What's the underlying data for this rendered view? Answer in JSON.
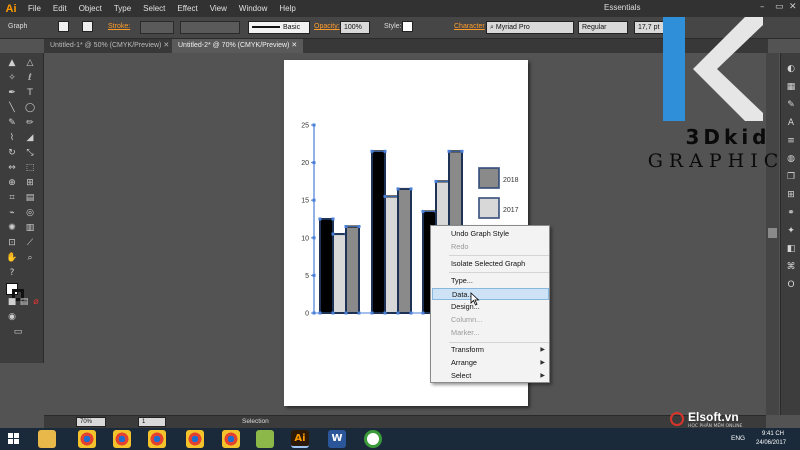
{
  "app": {
    "logo": "Ai"
  },
  "menubar": {
    "items": [
      "File",
      "Edit",
      "Object",
      "Type",
      "Select",
      "Effect",
      "View",
      "Window",
      "Help"
    ],
    "workspace": "Essentials",
    "win_min": "–",
    "win_max": "▭",
    "win_close": "✕"
  },
  "control_bar": {
    "selection_type": "Graph",
    "stroke_label": "Stroke:",
    "stroke_style": "Basic",
    "opacity_label": "Opacity:",
    "opacity_value": "100%",
    "style_label": "Style:",
    "character_label": "Character",
    "font_name": "Myriad Pro",
    "font_style": "Regular",
    "font_size": "17,7 pt",
    "fill_color": "#ffffff",
    "stroke_color": "#ffffff"
  },
  "tabs": [
    {
      "label": "Untitled-1* @ 50% (CMYK/Preview)"
    },
    {
      "label": "Untitled-2* @ 70% (CMYK/Preview)"
    }
  ],
  "statusbar": {
    "zoom": "70%",
    "page": "1",
    "tool": "Selection"
  },
  "context_menu": {
    "items": [
      {
        "label": "Undo Graph Style",
        "enabled": true
      },
      {
        "label": "Redo",
        "enabled": false
      },
      {
        "label": "Isolate Selected Graph",
        "enabled": true
      },
      {
        "label": "Type...",
        "enabled": true
      },
      {
        "label": "Data...",
        "enabled": true,
        "highlighted": true
      },
      {
        "label": "Design...",
        "enabled": true
      },
      {
        "label": "Column...",
        "enabled": false
      },
      {
        "label": "Marker...",
        "enabled": false
      },
      {
        "label": "Transform",
        "enabled": true,
        "submenu": true
      },
      {
        "label": "Arrange",
        "enabled": true,
        "submenu": true
      },
      {
        "label": "Select",
        "enabled": true,
        "submenu": true
      }
    ]
  },
  "watermark": {
    "line1": "3Dkid",
    "line2": "GRAPHIC"
  },
  "elsoft": {
    "name": "Elsoft.vn",
    "sub": "HỌC PHẦN MỀM ONLINE"
  },
  "taskbar": {
    "lang": "ENG",
    "time": "9:41 CH",
    "date": "24/06/2017"
  },
  "chart_data": {
    "type": "bar",
    "categories": [
      "",
      "",
      ""
    ],
    "series": [
      {
        "name": "",
        "color": "#000000",
        "values": [
          12.5,
          21.5,
          13.5
        ]
      },
      {
        "name": "2017",
        "color": "#d8d8d8",
        "values": [
          10.5,
          15.5,
          17.5
        ]
      },
      {
        "name": "2018",
        "color": "#8a8a8a",
        "values": [
          11.5,
          16.5,
          21.5
        ]
      }
    ],
    "yticks": [
      "0",
      "5",
      "10",
      "15",
      "20",
      "25"
    ],
    "ylim": [
      0,
      25
    ],
    "legend": [
      {
        "label": "2018",
        "color": "#8a8a8a"
      },
      {
        "label": "2017",
        "color": "#d8d8d8"
      }
    ]
  }
}
